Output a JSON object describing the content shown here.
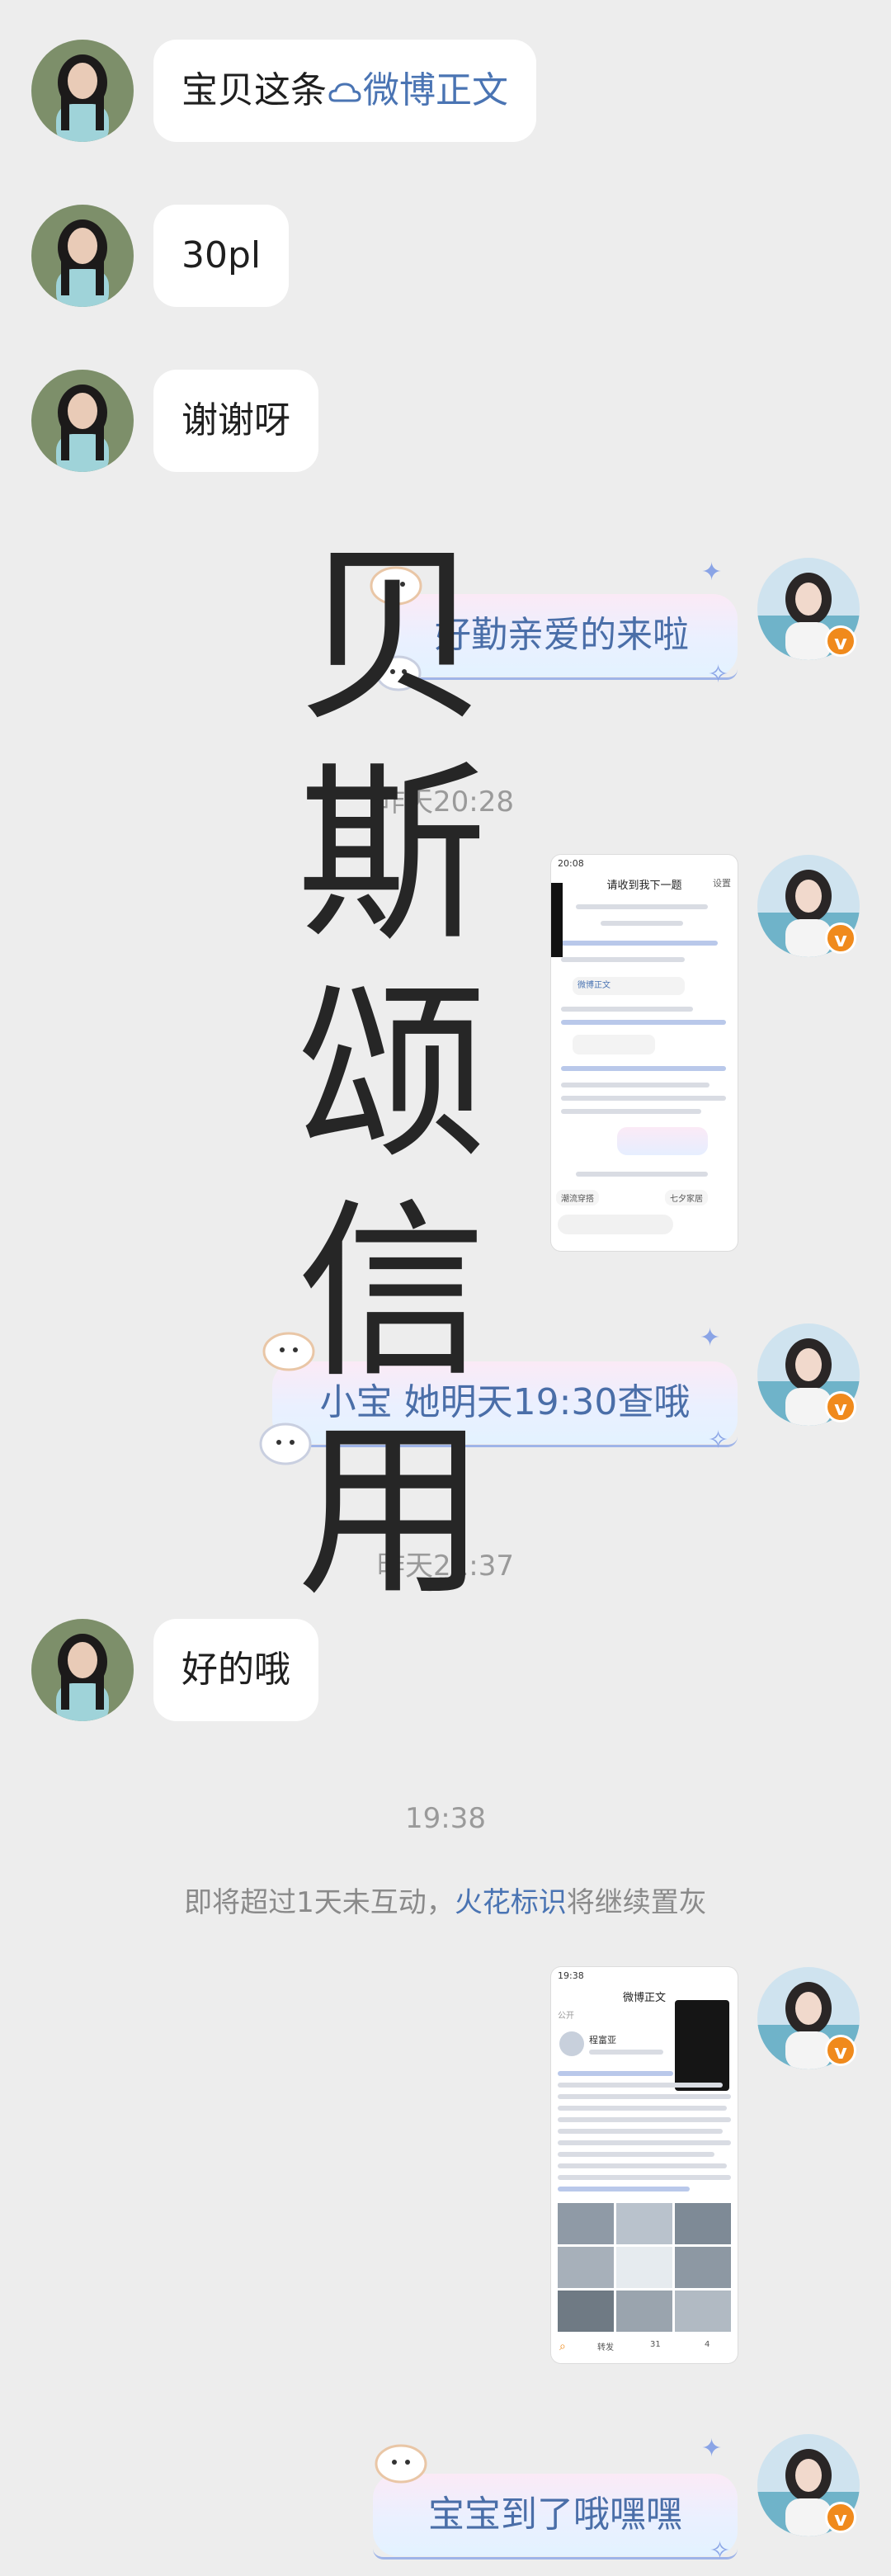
{
  "messages": {
    "m1": {
      "prefix": "宝贝这条",
      "link": "微博正文"
    },
    "m2": {
      "text": "30pl"
    },
    "m3": {
      "text": "谢谢呀"
    },
    "m4": {
      "text": "好勤亲爱的来啦"
    },
    "m5": {
      "text": "小宝 她明天19:30查哦"
    },
    "m6": {
      "text": "好的哦"
    },
    "m7": {
      "text": "宝宝到了哦嘿嘿"
    }
  },
  "timestamps": {
    "t1": "昨天20:28",
    "t2": "昨天21:37",
    "t3": "19:38"
  },
  "notice": {
    "before": "即将超过1天未互动，",
    "link": "火花标识",
    "after": "将继续置灰"
  },
  "watermark": [
    "贝",
    "斯",
    "颂",
    "信",
    "用"
  ],
  "shot1": {
    "status_time": "20:08",
    "header": "请收到我下一题",
    "btn": "设置",
    "link": "微博正文",
    "tags": [
      "潮流穿搭",
      "七夕家居"
    ]
  },
  "shot2": {
    "status_time": "19:38",
    "header": "微博正文",
    "back": "公开",
    "username": "程富亚",
    "btn_forward": "转发",
    "count_comment": "31",
    "count_like": "4"
  },
  "colors": {
    "background": "#ededed",
    "bubble": "#ffffff",
    "link": "#4a74b3",
    "badge": "#f08a1c"
  }
}
